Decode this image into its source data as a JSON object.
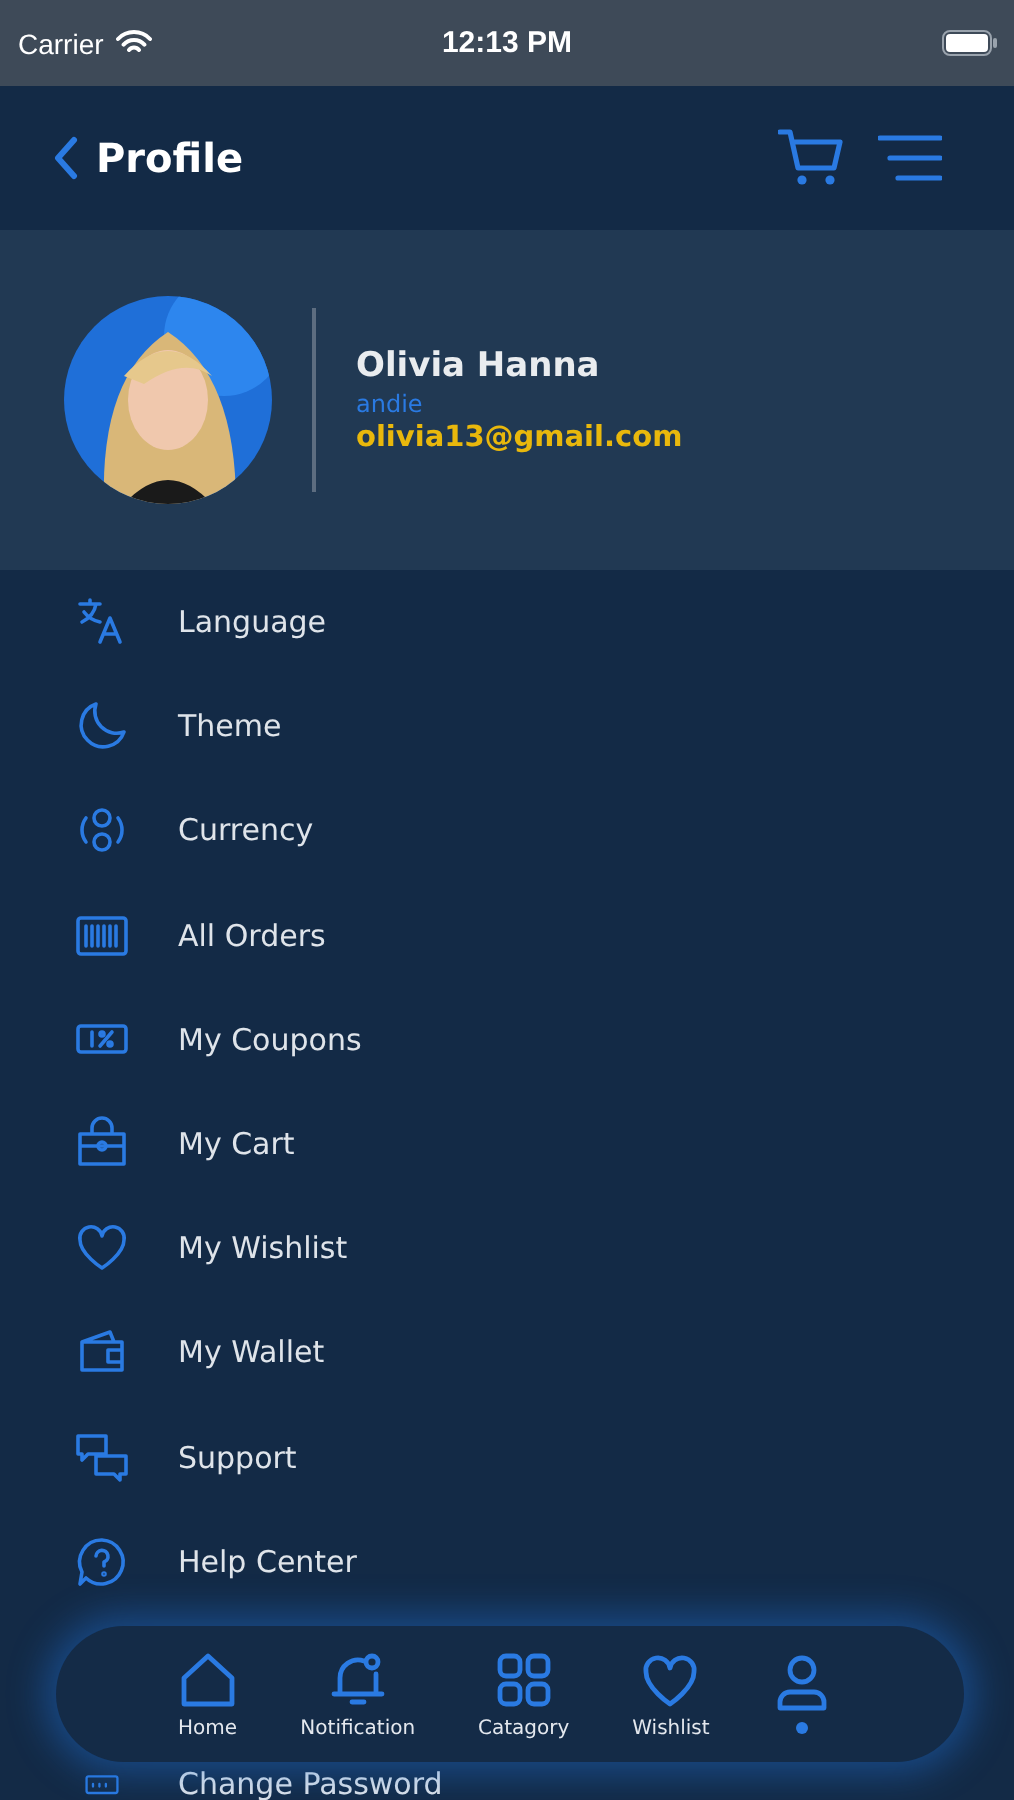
{
  "status_bar": {
    "carrier": "Carrier",
    "time": "12:13 PM"
  },
  "header": {
    "title": "Profile"
  },
  "profile": {
    "name": "Olivia Hanna",
    "username": "andie",
    "email": "olivia13@gmail.com"
  },
  "menu": [
    {
      "kind": "language",
      "label": "Language"
    },
    {
      "kind": "theme",
      "label": "Theme"
    },
    {
      "kind": "currency",
      "label": "Currency"
    },
    {
      "kind": "orders",
      "label": "All Orders"
    },
    {
      "kind": "coupons",
      "label": "My Coupons"
    },
    {
      "kind": "cart",
      "label": "My Cart"
    },
    {
      "kind": "wishlist",
      "label": "My Wishlist"
    },
    {
      "kind": "wallet",
      "label": "My Wallet"
    },
    {
      "kind": "support",
      "label": "Support"
    },
    {
      "kind": "help",
      "label": "Help Center"
    },
    {
      "kind": "password",
      "label": "Change Password"
    }
  ],
  "bottom_nav": [
    {
      "kind": "home",
      "label": "Home",
      "selected": false
    },
    {
      "kind": "notification",
      "label": "Notification",
      "selected": false
    },
    {
      "kind": "category",
      "label": "Catagory",
      "selected": false
    },
    {
      "kind": "wishlist",
      "label": "Wishlist",
      "selected": false
    },
    {
      "kind": "profile",
      "selected": true
    }
  ]
}
